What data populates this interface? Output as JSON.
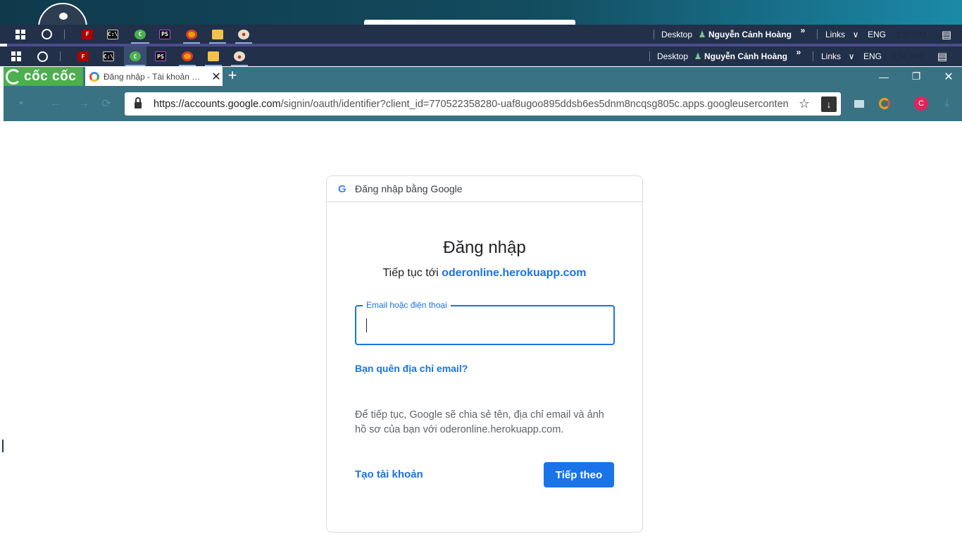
{
  "taskbar_top": {
    "desktop_label": "Desktop",
    "user_name": "Nguyễn Cảnh Hoàng",
    "chevron": "»",
    "links_label": "Links",
    "lang": "ENG",
    "time": "3:32 PM"
  },
  "taskbar_bottom": {
    "desktop_label": "Desktop",
    "user_name": "Nguyễn Cảnh Hoàng",
    "chevron": "»",
    "links_label": "Links",
    "lang": "ENG",
    "time": "3:34 PM"
  },
  "taskbar_apps": [
    "start-icon",
    "cortana-icon",
    "filezilla-icon",
    "cmd-icon",
    "coccoc-icon",
    "phpstorm-icon",
    "chrome-icon",
    "file-explorer-icon",
    "paint-icon"
  ],
  "browser": {
    "logo_text": "cốc cốc",
    "tab_title": "Đăng nhập - Tài khoản Google",
    "new_tab": "+",
    "close_tab": "✕",
    "url_host": "https://accounts.google.com",
    "url_path": "/signin/oauth/identifier?client_id=770522358280-uaf8ugoo895ddsb6es5dnm8ncqsg805c.apps.googleusercontent.c..."
  },
  "signin": {
    "header": "Đăng nhập bằng Google",
    "title": "Đăng nhập",
    "subtitle_prefix": "Tiếp tục tới",
    "subtitle_site": "oderonline.herokuapp.com",
    "email_label": "Email hoặc điện thoại",
    "email_value": "",
    "forgot_email": "Bạn quên địa chỉ email?",
    "notice": "Để tiếp tục, Google sẽ chia sẻ tên, địa chỉ email và ảnh hồ sơ của bạn với oderonline.herokuapp.com.",
    "create_account": "Tạo tài khoản",
    "next_button": "Tiếp theo"
  },
  "colors": {
    "accent": "#1a73e8",
    "browser_chrome": "#397282",
    "coccoc_green": "#4caf50",
    "taskbar": "#22304a"
  }
}
